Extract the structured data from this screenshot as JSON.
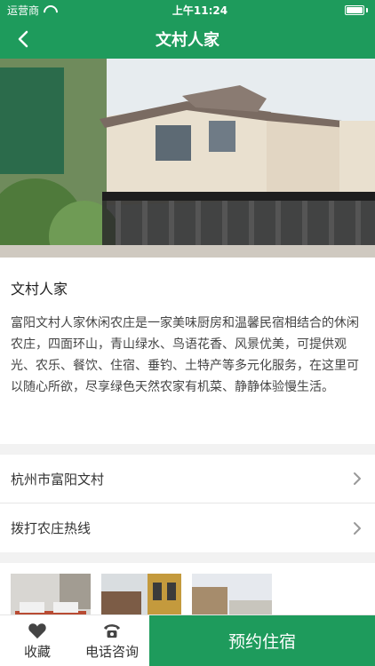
{
  "status": {
    "carrier": "运营商",
    "time": "上午11:24"
  },
  "nav": {
    "title": "文村人家"
  },
  "intro": {
    "title": "文村人家",
    "description": "富阳文村人家休闲农庄是一家美味厨房和温馨民宿相结合的休闲农庄，四面环山，青山绿水、鸟语花香、风景优美，可提供观光、农乐、餐饮、住宿、垂钓、土特产等多元化服务，在这里可以随心所欲，尽享绿色天然农家有机菜、静静体验慢生活。"
  },
  "list": [
    {
      "label": "杭州市富阳文村"
    },
    {
      "label": "拨打农庄热线"
    }
  ],
  "bottom": {
    "favorite": "收藏",
    "phone": "电话咨询",
    "reserve": "预约住宿"
  },
  "colors": {
    "brand": "#1e9b5c"
  },
  "icons": [
    "back-arrow-icon",
    "wifi-icon",
    "battery-icon",
    "chevron-right-icon",
    "heart-icon",
    "telephone-icon"
  ]
}
